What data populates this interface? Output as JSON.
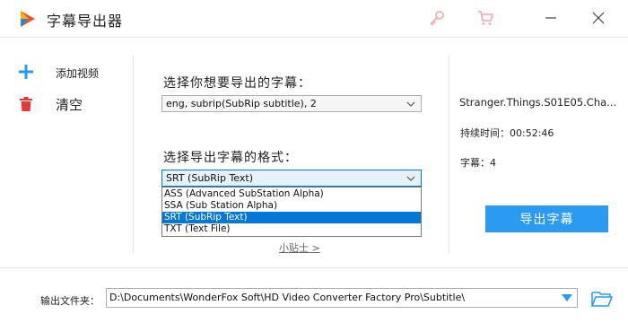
{
  "window": {
    "title": "字幕导出器",
    "icons": [
      "app-logo",
      "key-icon",
      "cart-icon",
      "minimize-icon",
      "close-icon"
    ]
  },
  "sidebar": {
    "items": [
      {
        "label": "添加视频",
        "icon": "plus-icon"
      },
      {
        "label": "清空",
        "icon": "trash-icon"
      }
    ]
  },
  "main": {
    "subtitle_label": "选择你想要导出的字幕：",
    "subtitle_select": {
      "value": "eng, subrip(SubRip subtitle), 2"
    },
    "format_label": "选择导出字幕的格式：",
    "format_select": {
      "value": "SRT (SubRip Text)",
      "options": [
        "ASS (Advanced SubStation Alpha)",
        "SSA (Sub Station Alpha)",
        "SRT (SubRip Text)",
        "TXT (Text File)"
      ],
      "selected_index": 2
    },
    "tip_link": "小贴士 >"
  },
  "info": {
    "filename": "Stranger.Things.S01E05.Cha...",
    "duration": "持续时间：00:52:46",
    "subtitles": "字幕：4"
  },
  "export_button": "导出字幕",
  "output": {
    "label": "输出文件夹：",
    "path": "D:\\Documents\\WonderFox Soft\\HD Video Converter Factory Pro\\Subtitle\\"
  },
  "colors": {
    "accent": "#2b9af3",
    "selection": "#0078d7",
    "plus": "#2b9af3",
    "trash": "#e53935",
    "toolbar_icons": "#f3a5a5"
  }
}
